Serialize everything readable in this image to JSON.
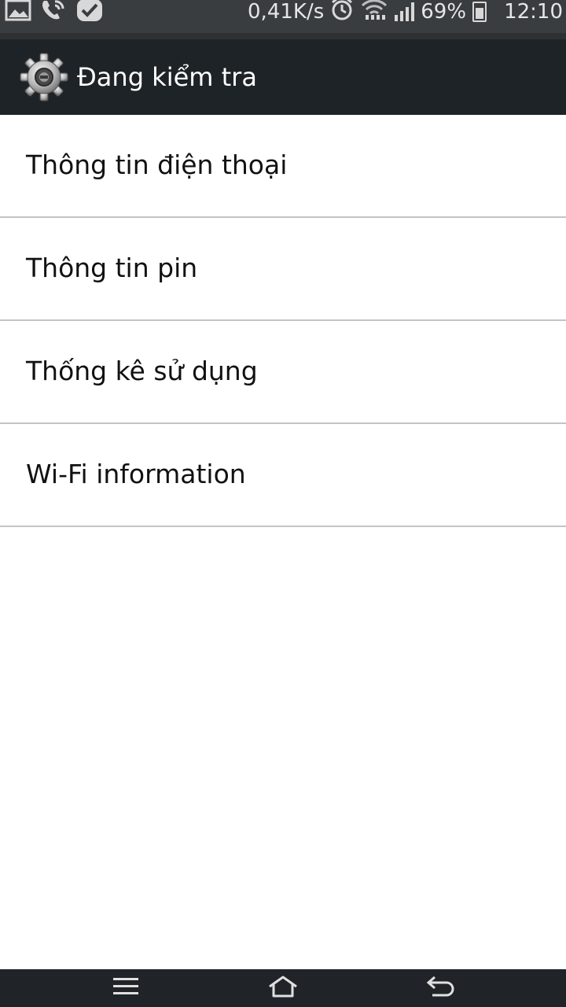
{
  "status_bar": {
    "net_speed": "0,41K/s",
    "battery": "69%",
    "time": "12:10",
    "icons": [
      "image-icon",
      "phone-call-icon",
      "checkmark-icon",
      "alarm-icon",
      "wifi-icon",
      "signal-icon",
      "battery-icon"
    ]
  },
  "action_bar": {
    "icon": "gear-icon",
    "title": "Đang kiểm tra"
  },
  "menu": {
    "items": [
      {
        "label": "Thông tin điện thoại"
      },
      {
        "label": "Thông tin pin"
      },
      {
        "label": "Thống kê sử dụng"
      },
      {
        "label": "Wi-Fi information"
      }
    ]
  },
  "nav_bar": {
    "icons": [
      "menu-icon",
      "home-icon",
      "back-icon"
    ]
  },
  "colors": {
    "status_bar_bg": "#3a3d40",
    "action_bar_bg": "#1e2328",
    "nav_bar_bg": "#202428",
    "divider": "#c4c4c4",
    "list_bg": "#ffffff"
  }
}
